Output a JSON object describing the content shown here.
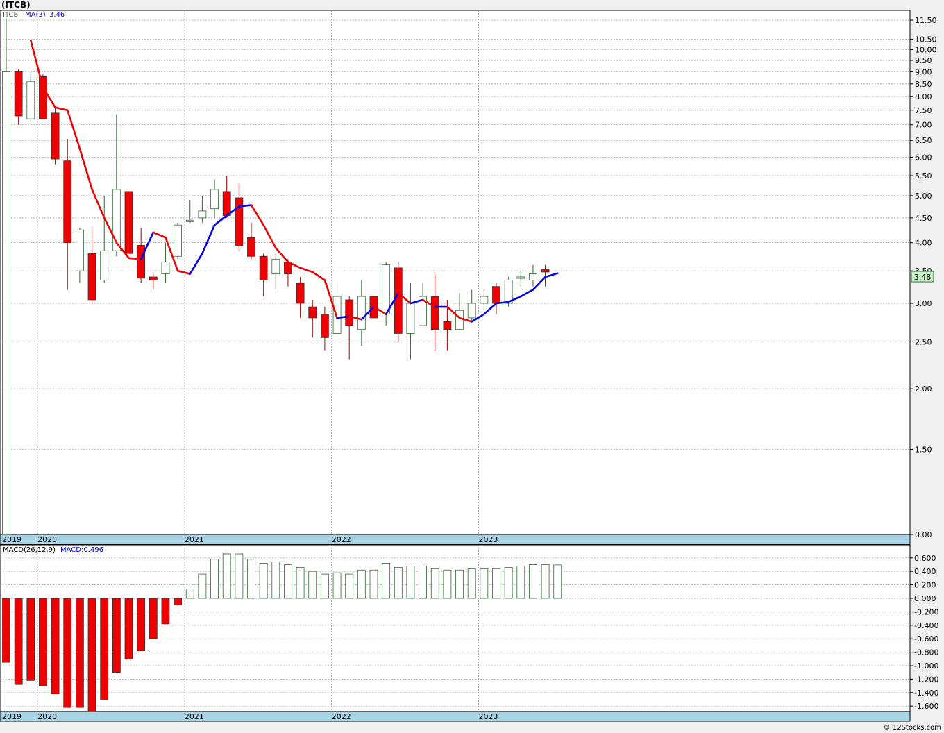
{
  "header": {
    "title": "(ITCB)"
  },
  "footer": {
    "copyright": "© 12Stocks.com"
  },
  "colors": {
    "up_body": "#ffffff",
    "up_stroke": "#2e6b2e",
    "down_body": "#ee0000",
    "down_stroke": "#333333",
    "ma_down": "#ee0000",
    "ma_up": "#0000ee",
    "year_band": "#a9d4e6",
    "grid": "#a0a0a0",
    "price_tag": "#c8f0c8"
  },
  "chart_data": [
    {
      "type": "candlestick",
      "symbol": "ITCB",
      "legend": {
        "symbol_label": "ITCB",
        "ma_label": "MA(3)",
        "ma_value": "3.46"
      },
      "last_price_label": "3.48",
      "y_scale": "log",
      "y_ticks": [
        "11.50",
        "10.50",
        "10.00",
        "9.50",
        "9.00",
        "8.50",
        "8.00",
        "7.50",
        "7.00",
        "6.50",
        "6.00",
        "5.50",
        "5.00",
        "4.50",
        "4.00",
        "3.50",
        "3.00",
        "2.50",
        "2.00",
        "1.50",
        "0.00"
      ],
      "x_year_labels": [
        "2019",
        "2020",
        "2021",
        "2022",
        "2023"
      ],
      "candles": [
        {
          "o": 3.5,
          "h": 11.6,
          "l": 0.5,
          "c": 9.0
        },
        {
          "o": 9.0,
          "h": 9.1,
          "l": 7.0,
          "c": 7.3
        },
        {
          "o": 7.2,
          "h": 8.9,
          "l": 7.1,
          "c": 8.6
        },
        {
          "o": 8.8,
          "h": 8.9,
          "l": 7.2,
          "c": 7.2
        },
        {
          "o": 7.4,
          "h": 7.6,
          "l": 5.8,
          "c": 5.95
        },
        {
          "o": 5.9,
          "h": 6.55,
          "l": 3.2,
          "c": 4.0
        },
        {
          "o": 3.5,
          "h": 4.3,
          "l": 3.3,
          "c": 4.25
        },
        {
          "o": 3.8,
          "h": 4.3,
          "l": 3.0,
          "c": 3.05
        },
        {
          "o": 3.35,
          "h": 5.0,
          "l": 3.3,
          "c": 3.85
        },
        {
          "o": 3.85,
          "h": 7.35,
          "l": 3.75,
          "c": 5.15
        },
        {
          "o": 5.1,
          "h": 5.1,
          "l": 3.8,
          "c": 3.8
        },
        {
          "o": 3.95,
          "h": 4.3,
          "l": 3.3,
          "c": 3.38
        },
        {
          "o": 3.4,
          "h": 3.45,
          "l": 3.2,
          "c": 3.35
        },
        {
          "o": 3.45,
          "h": 4.0,
          "l": 3.3,
          "c": 3.65
        },
        {
          "o": 3.75,
          "h": 4.4,
          "l": 3.7,
          "c": 4.35
        },
        {
          "o": 4.45,
          "h": 4.9,
          "l": 4.4,
          "c": 4.45
        },
        {
          "o": 4.5,
          "h": 5.0,
          "l": 4.4,
          "c": 4.65
        },
        {
          "o": 4.7,
          "h": 5.4,
          "l": 4.5,
          "c": 5.15
        },
        {
          "o": 5.1,
          "h": 5.5,
          "l": 4.5,
          "c": 4.55
        },
        {
          "o": 4.95,
          "h": 5.3,
          "l": 3.85,
          "c": 3.95
        },
        {
          "o": 4.1,
          "h": 4.4,
          "l": 3.7,
          "c": 3.75
        },
        {
          "o": 3.75,
          "h": 3.8,
          "l": 3.1,
          "c": 3.35
        },
        {
          "o": 3.45,
          "h": 3.8,
          "l": 3.2,
          "c": 3.7
        },
        {
          "o": 3.65,
          "h": 3.7,
          "l": 3.25,
          "c": 3.45
        },
        {
          "o": 3.3,
          "h": 3.4,
          "l": 2.8,
          "c": 3.0
        },
        {
          "o": 2.95,
          "h": 3.05,
          "l": 2.55,
          "c": 2.8
        },
        {
          "o": 2.85,
          "h": 2.95,
          "l": 2.4,
          "c": 2.55
        },
        {
          "o": 2.6,
          "h": 3.3,
          "l": 2.6,
          "c": 3.1
        },
        {
          "o": 3.05,
          "h": 3.1,
          "l": 2.3,
          "c": 2.7
        },
        {
          "o": 2.65,
          "h": 3.35,
          "l": 2.45,
          "c": 3.1
        },
        {
          "o": 3.1,
          "h": 3.1,
          "l": 2.8,
          "c": 2.8
        },
        {
          "o": 2.85,
          "h": 3.65,
          "l": 2.7,
          "c": 3.6
        },
        {
          "o": 3.55,
          "h": 3.65,
          "l": 2.5,
          "c": 2.6
        },
        {
          "o": 2.6,
          "h": 3.3,
          "l": 2.3,
          "c": 3.0
        },
        {
          "o": 2.7,
          "h": 3.3,
          "l": 2.7,
          "c": 3.1
        },
        {
          "o": 3.1,
          "h": 3.45,
          "l": 2.4,
          "c": 2.65
        },
        {
          "o": 2.75,
          "h": 3.05,
          "l": 2.4,
          "c": 2.65
        },
        {
          "o": 2.65,
          "h": 3.15,
          "l": 2.65,
          "c": 2.9
        },
        {
          "o": 2.8,
          "h": 3.2,
          "l": 2.75,
          "c": 3.0
        },
        {
          "o": 3.0,
          "h": 3.2,
          "l": 2.9,
          "c": 3.1
        },
        {
          "o": 3.25,
          "h": 3.3,
          "l": 2.85,
          "c": 3.0
        },
        {
          "o": 3.0,
          "h": 3.4,
          "l": 2.95,
          "c": 3.35
        },
        {
          "o": 3.4,
          "h": 3.5,
          "l": 3.25,
          "c": 3.4
        },
        {
          "o": 3.35,
          "h": 3.6,
          "l": 3.25,
          "c": 3.45
        },
        {
          "o": 3.52,
          "h": 3.6,
          "l": 3.25,
          "c": 3.48
        }
      ],
      "ma": [
        null,
        null,
        10.45,
        8.35,
        7.6,
        7.5,
        6.25,
        5.15,
        4.5,
        4.0,
        3.72,
        3.7,
        4.2,
        4.1,
        3.5,
        3.45,
        3.8,
        4.35,
        4.55,
        4.75,
        4.78,
        4.35,
        3.9,
        3.65,
        3.55,
        3.48,
        3.35,
        2.8,
        2.82,
        2.78,
        2.95,
        2.85,
        3.15,
        3.0,
        3.05,
        2.95,
        2.95,
        2.8,
        2.75,
        2.85,
        3.0,
        3.02,
        3.1,
        3.2,
        3.4,
        3.46
      ]
    },
    {
      "type": "bar",
      "name": "MACD",
      "legend": {
        "params_label": "MACD(26,12,9)",
        "value_label": "MACD:0.496"
      },
      "y_ticks": [
        "0.600",
        "0.400",
        "0.200",
        "0.000",
        "-0.200",
        "-0.400",
        "-0.600",
        "-0.800",
        "-1.000",
        "-1.200",
        "-1.400",
        "-1.600"
      ],
      "y_range": [
        -1.66,
        0.66
      ],
      "x_year_labels": [
        "2019",
        "2020",
        "2021",
        "2022",
        "2023"
      ],
      "values": [
        -0.95,
        -1.28,
        -1.22,
        -1.3,
        -1.42,
        -1.62,
        -1.62,
        -1.68,
        -1.5,
        -1.1,
        -0.9,
        -0.78,
        -0.6,
        -0.38,
        -0.1,
        0.14,
        0.36,
        0.58,
        0.66,
        0.66,
        0.58,
        0.52,
        0.54,
        0.5,
        0.46,
        0.4,
        0.36,
        0.38,
        0.36,
        0.42,
        0.42,
        0.52,
        0.46,
        0.48,
        0.48,
        0.44,
        0.42,
        0.42,
        0.44,
        0.44,
        0.44,
        0.46,
        0.48,
        0.5,
        0.5,
        0.496
      ]
    }
  ]
}
